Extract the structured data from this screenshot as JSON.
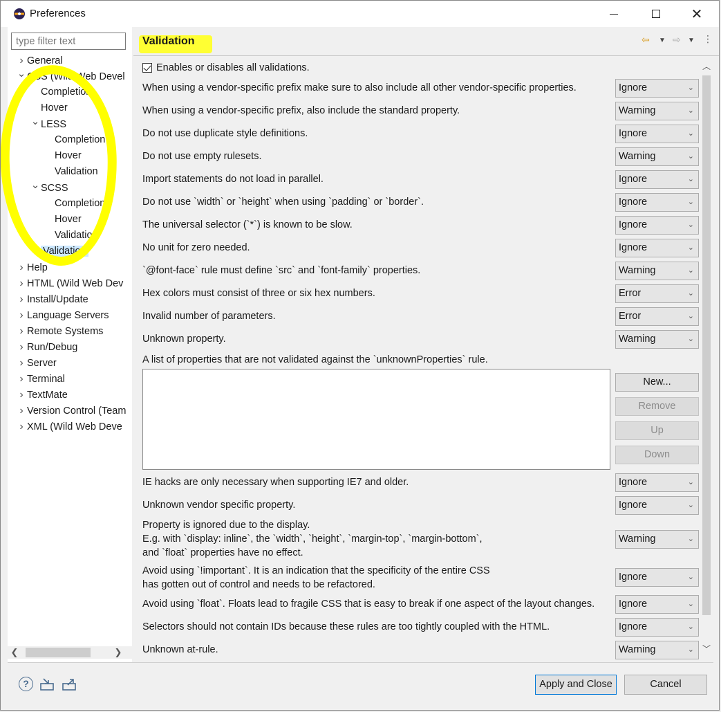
{
  "window": {
    "title": "Preferences"
  },
  "filter": {
    "placeholder": "type filter text"
  },
  "tree": [
    {
      "label": "General",
      "indent": 0,
      "toggle": "right"
    },
    {
      "label": "CSS (Wild Web Devel",
      "indent": 0,
      "toggle": "down"
    },
    {
      "label": "Completion",
      "indent": 1,
      "toggle": ""
    },
    {
      "label": "Hover",
      "indent": 1,
      "toggle": ""
    },
    {
      "label": "LESS",
      "indent": 1,
      "toggle": "down"
    },
    {
      "label": "Completion",
      "indent": 2,
      "toggle": ""
    },
    {
      "label": "Hover",
      "indent": 2,
      "toggle": ""
    },
    {
      "label": "Validation",
      "indent": 2,
      "toggle": ""
    },
    {
      "label": "SCSS",
      "indent": 1,
      "toggle": "down"
    },
    {
      "label": "Completion",
      "indent": 2,
      "toggle": ""
    },
    {
      "label": "Hover",
      "indent": 2,
      "toggle": ""
    },
    {
      "label": "Validation",
      "indent": 2,
      "toggle": ""
    },
    {
      "label": "Validation",
      "indent": 1,
      "toggle": "",
      "selected": true
    },
    {
      "label": "Help",
      "indent": 0,
      "toggle": "right"
    },
    {
      "label": "HTML (Wild Web Dev",
      "indent": 0,
      "toggle": "right"
    },
    {
      "label": "Install/Update",
      "indent": 0,
      "toggle": "right"
    },
    {
      "label": "Language Servers",
      "indent": 0,
      "toggle": "right"
    },
    {
      "label": "Remote Systems",
      "indent": 0,
      "toggle": "right"
    },
    {
      "label": "Run/Debug",
      "indent": 0,
      "toggle": "right"
    },
    {
      "label": "Server",
      "indent": 0,
      "toggle": "right"
    },
    {
      "label": "Terminal",
      "indent": 0,
      "toggle": "right"
    },
    {
      "label": "TextMate",
      "indent": 0,
      "toggle": "right"
    },
    {
      "label": "Version Control (Team",
      "indent": 0,
      "toggle": "right"
    },
    {
      "label": "XML (Wild Web Deve",
      "indent": 0,
      "toggle": "right"
    }
  ],
  "page": {
    "title": "Validation",
    "master_checkbox": "Enables or disables all validations.",
    "rules_top": [
      {
        "label": "When using a vendor-specific prefix make sure to also include all other vendor-specific properties.",
        "value": "Ignore"
      },
      {
        "label": "When using a vendor-specific prefix, also include the standard property.",
        "value": "Warning"
      },
      {
        "label": "Do not use duplicate style definitions.",
        "value": "Ignore"
      },
      {
        "label": "Do not use empty rulesets.",
        "value": "Warning"
      },
      {
        "label": "Import statements do not load in parallel.",
        "value": "Ignore"
      },
      {
        "label": "Do not use `width` or `height` when using `padding` or `border`.",
        "value": "Ignore"
      },
      {
        "label": "The universal selector (`*`) is known to be slow.",
        "value": "Ignore"
      },
      {
        "label": "No unit for zero needed.",
        "value": "Ignore"
      },
      {
        "label": "`@font-face` rule must define `src` and `font-family` properties.",
        "value": "Warning"
      },
      {
        "label": "Hex colors must consist of three or six hex numbers.",
        "value": "Error"
      },
      {
        "label": "Invalid number of parameters.",
        "value": "Error"
      },
      {
        "label": "Unknown property.",
        "value": "Warning"
      }
    ],
    "list_label": "A list of properties that are not validated against the `unknownProperties` rule.",
    "list_buttons": {
      "new": "New...",
      "remove": "Remove",
      "up": "Up",
      "down": "Down"
    },
    "rules_bottom": [
      {
        "label": "IE hacks are only necessary when supporting IE7 and older.",
        "value": "Ignore"
      },
      {
        "label": "Unknown vendor specific property.",
        "value": "Ignore"
      },
      {
        "label": "Property is ignored due to the display.\nE.g. with `display: inline`, the `width`, `height`, `margin-top`, `margin-bottom`,\nand `float` properties have no effect.",
        "value": "Warning"
      },
      {
        "label": "Avoid using `!important`. It is an indication that the specificity of the entire CSS\nhas gotten out of control and needs to be refactored.",
        "value": "Ignore"
      },
      {
        "label": "Avoid using `float`. Floats lead to fragile CSS that is easy to break if one aspect of the layout changes.",
        "value": "Ignore"
      },
      {
        "label": "Selectors should not contain IDs because these rules are too tightly coupled with the HTML.",
        "value": "Ignore"
      },
      {
        "label": "Unknown at-rule.",
        "value": "Warning"
      }
    ]
  },
  "buttons": {
    "apply_close": "Apply and Close",
    "cancel": "Cancel"
  },
  "colors": {
    "highlight": "#ffff00",
    "selection": "#cce8ff",
    "default_button_border": "#0078d7"
  }
}
